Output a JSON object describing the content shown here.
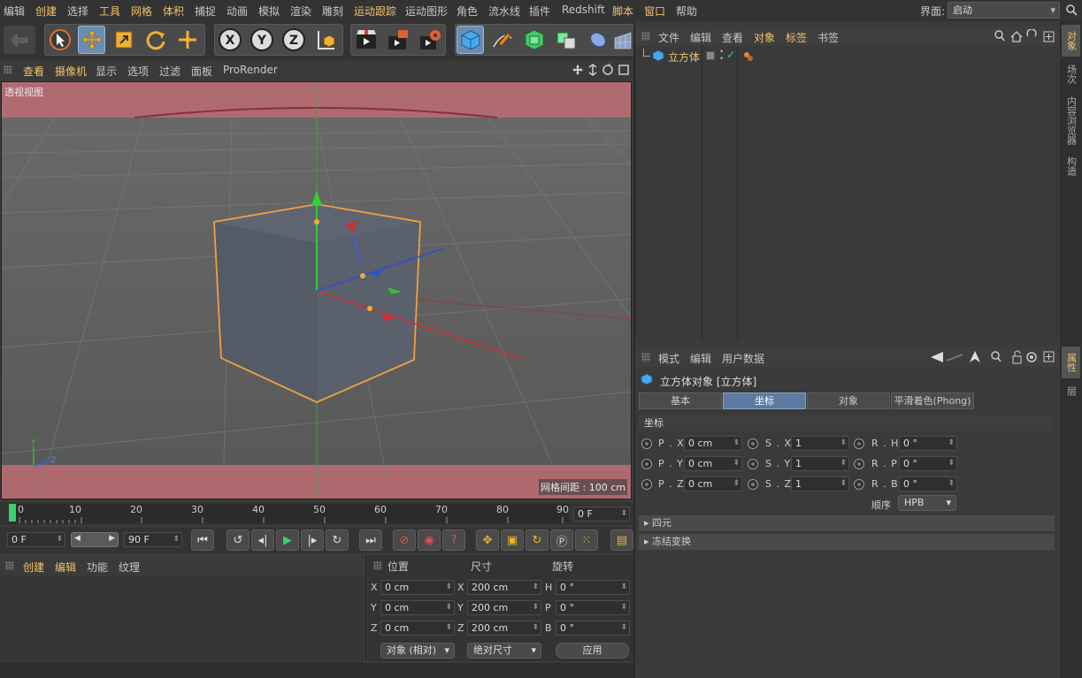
{
  "menubar": {
    "items": [
      {
        "label": "编辑",
        "hl": false
      },
      {
        "label": "创建",
        "hl": true
      },
      {
        "label": "选择",
        "hl": false
      },
      {
        "label": "工具",
        "hl": true
      },
      {
        "label": "网格",
        "hl": true
      },
      {
        "label": "体积",
        "hl": true
      },
      {
        "label": "捕捉",
        "hl": false
      },
      {
        "label": "动画",
        "hl": false
      },
      {
        "label": "模拟",
        "hl": false
      },
      {
        "label": "渲染",
        "hl": false
      },
      {
        "label": "雕刻",
        "hl": false
      },
      {
        "label": "运动跟踪",
        "hl": true
      },
      {
        "label": "运动图形",
        "hl": false
      },
      {
        "label": "角色",
        "hl": false
      },
      {
        "label": "流水线",
        "hl": false
      },
      {
        "label": "插件",
        "hl": false
      },
      {
        "label": "Redshift",
        "hl": false
      },
      {
        "label": "脚本",
        "hl": true
      },
      {
        "label": "窗口",
        "hl": true
      },
      {
        "label": "帮助",
        "hl": false
      }
    ],
    "layout_label": "界面:",
    "layout_value": "启动"
  },
  "toolbar": {
    "axis_x": "X",
    "axis_y": "Y",
    "axis_z": "Z"
  },
  "viewport": {
    "menu": [
      "查看",
      "摄像机",
      "显示",
      "选项",
      "过滤",
      "面板",
      "ProRender"
    ],
    "view_name": "透视视图",
    "grid_spacing": "网格间距 : 100 cm",
    "axis_x": "X",
    "axis_y": "Y",
    "axis_z": "Z"
  },
  "object_manager": {
    "menu": [
      "文件",
      "编辑",
      "查看",
      "对象",
      "标签",
      "书签"
    ],
    "objects": [
      {
        "name": "立方体"
      }
    ]
  },
  "right_tabs": {
    "top": [
      "对象",
      "场次",
      "内容浏览器",
      "构造"
    ],
    "bottom": [
      "属性",
      "层"
    ]
  },
  "attributes": {
    "menu": [
      "模式",
      "编辑",
      "用户数据"
    ],
    "title": "立方体对象 [立方体]",
    "tabs": [
      "基本",
      "坐标",
      "对象",
      "平滑着色(Phong)"
    ],
    "active_tab": "坐标",
    "section_coord": "坐标",
    "rows": [
      [
        {
          "label": "P . X",
          "value": "0 cm"
        },
        {
          "label": "S . X",
          "value": "1"
        },
        {
          "label": "R . H",
          "value": "0 °"
        }
      ],
      [
        {
          "label": "P . Y",
          "value": "0 cm"
        },
        {
          "label": "S . Y",
          "value": "1"
        },
        {
          "label": "R . P",
          "value": "0 °"
        }
      ],
      [
        {
          "label": "P . Z",
          "value": "0 cm"
        },
        {
          "label": "S . Z",
          "value": "1"
        },
        {
          "label": "R . B",
          "value": "0 °"
        }
      ]
    ],
    "order_label": "顺序",
    "order_value": "HPB",
    "section_quat": "四元",
    "section_freeze": "冻结变换"
  },
  "timeline": {
    "ticks": [
      "0",
      "10",
      "20",
      "30",
      "40",
      "50",
      "60",
      "70",
      "80",
      "90"
    ],
    "current_frame": "0 F",
    "start_frame": "0 F",
    "end_frame": "90 F"
  },
  "materials": {
    "menu": [
      "创建",
      "编辑",
      "功能",
      "纹理"
    ]
  },
  "coordinates": {
    "headers": [
      "位置",
      "尺寸",
      "旋转"
    ],
    "rows": [
      {
        "pl": "X",
        "pv": "0 cm",
        "sl": "X",
        "sv": "200 cm",
        "rl": "H",
        "rv": "0 °"
      },
      {
        "pl": "Y",
        "pv": "0 cm",
        "sl": "Y",
        "sv": "200 cm",
        "rl": "P",
        "rv": "0 °"
      },
      {
        "pl": "Z",
        "pv": "0 cm",
        "sl": "Z",
        "sv": "200 cm",
        "rl": "B",
        "rv": "0 °"
      }
    ],
    "mode": "对象 (相对)",
    "size_mode": "绝对尺寸",
    "apply": "应用"
  }
}
